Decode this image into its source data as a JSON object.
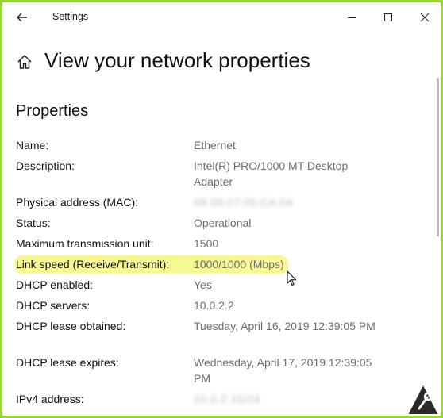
{
  "window": {
    "title": "Settings",
    "accent": "#9bd43a"
  },
  "icons": {
    "back": "back-arrow-icon",
    "home": "home-icon",
    "minimize": "minimize-icon",
    "maximize": "maximize-icon",
    "close": "close-icon"
  },
  "page": {
    "title": "View your network properties",
    "section": "Properties"
  },
  "properties": [
    {
      "label": "Name:",
      "value": "Ethernet"
    },
    {
      "label": "Description:",
      "value": "Intel(R) PRO/1000 MT Desktop Adapter"
    },
    {
      "label": "Physical address (MAC):",
      "value": "08:00:27:05:CA:04"
    },
    {
      "label": "Status:",
      "value": "Operational"
    },
    {
      "label": "Maximum transmission unit:",
      "value": "1500"
    },
    {
      "label": "Link speed (Receive/Transmit):",
      "value": "1000/1000 (Mbps)"
    },
    {
      "label": "DHCP enabled:",
      "value": "Yes"
    },
    {
      "label": "DHCP servers:",
      "value": "10.0.2.2"
    },
    {
      "label": "DHCP lease obtained:",
      "value": "Tuesday, April 16, 2019 12:39:05 PM"
    },
    {
      "label": "DHCP lease expires:",
      "value": "Wednesday, April 17, 2019 12:39:05 PM"
    },
    {
      "label": "IPv4 address:",
      "value": "10.0.2.15/24"
    }
  ],
  "highlight_color": "#f7f795"
}
